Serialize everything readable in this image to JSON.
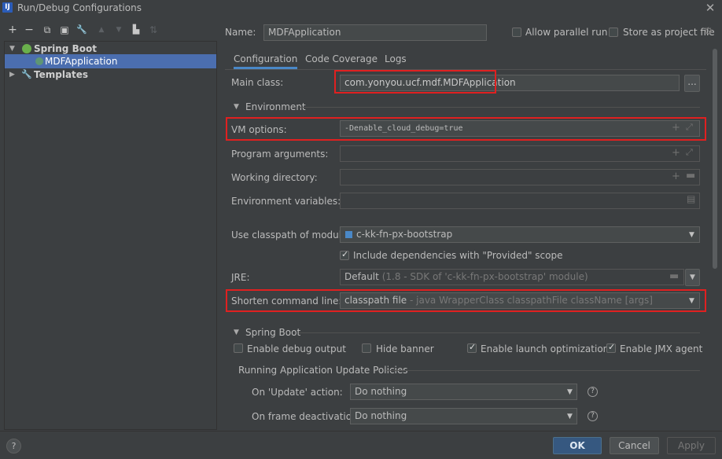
{
  "window": {
    "title": "Run/Debug Configurations",
    "app_icon": "intellij-icon",
    "close_glyph": "✕"
  },
  "toolbar": {
    "add": "+",
    "remove": "−",
    "copy": "⧉",
    "save": "▣",
    "wrench": "🔧",
    "up": "▲",
    "down": "▼",
    "folder": "▙",
    "sort": "⇅"
  },
  "tree": {
    "group_label": "Spring Boot",
    "item_label": "MDFApplication",
    "templates_label": "Templates"
  },
  "name_row": {
    "label": "Name:",
    "value": "MDFApplication",
    "allow_parallel_label": "Allow parallel run",
    "store_project_label": "Store as project file"
  },
  "tabs": [
    "Configuration",
    "Code Coverage",
    "Logs"
  ],
  "form": {
    "main_class_label": "Main class:",
    "main_class_value": "com.yonyou.ucf.mdf.MDFApplication",
    "browse_label": "...",
    "environment_header": "Environment",
    "vm_options_label": "VM options:",
    "vm_options_value": "-Denable_cloud_debug=true",
    "program_args_label": "Program arguments:",
    "working_dir_label": "Working directory:",
    "env_vars_label": "Environment variables:",
    "classpath_module_label": "Use classpath of module:",
    "classpath_module_value": "c-kk-fn-px-bootstrap",
    "include_deps_label": "Include dependencies with \"Provided\" scope",
    "jre_label": "JRE:",
    "jre_value": "Default",
    "jre_hint": "(1.8 - SDK of 'c-kk-fn-px-bootstrap' module)",
    "shorten_label": "Shorten command line:",
    "shorten_value": "classpath file",
    "shorten_hint": "- java WrapperClass classpathFile className [args]",
    "spring_boot_header": "Spring Boot",
    "enable_debug_label": "Enable debug output",
    "hide_banner_label": "Hide banner",
    "launch_opt_label": "Enable launch optimization",
    "jmx_label": "Enable JMX agent",
    "policies_header": "Running Application Update Policies",
    "on_update_label": "On 'Update' action:",
    "on_update_value": "Do nothing",
    "on_frame_label": "On frame deactivation:",
    "on_frame_value": "Do nothing"
  },
  "footer": {
    "help": "?",
    "ok": "OK",
    "cancel": "Cancel",
    "apply": "Apply"
  },
  "colors": {
    "background": "#3c3f41",
    "selection": "#4b6eaf",
    "highlight_box": "#e02020",
    "primary_button": "#365880",
    "tab_underline": "#4a88c7"
  }
}
